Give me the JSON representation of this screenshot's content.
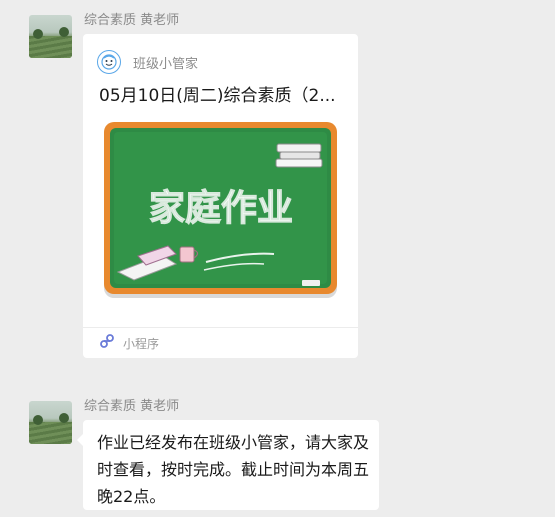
{
  "messages": [
    {
      "sender": "综合素质 黄老师",
      "type": "mini_program_card",
      "app_name": "班级小管家",
      "title": "05月10日(周二)综合素质（2...",
      "cover_text": "家庭作业",
      "footer_label": "小程序"
    },
    {
      "sender": "综合素质 黄老师",
      "type": "text",
      "text": "作业已经发布在班级小管家，请大家及时查看，按时完成。截止时间为本周五晚22点。"
    }
  ],
  "colors": {
    "background": "#ededed",
    "bubble": "#ffffff",
    "chalkboard": "#2e8b45",
    "board_frame": "#e8892e",
    "sender_text": "#8a8a8a"
  },
  "icons": {
    "mini_program_logo": "smiling-face-icon",
    "mini_program_footer": "link-icon"
  }
}
